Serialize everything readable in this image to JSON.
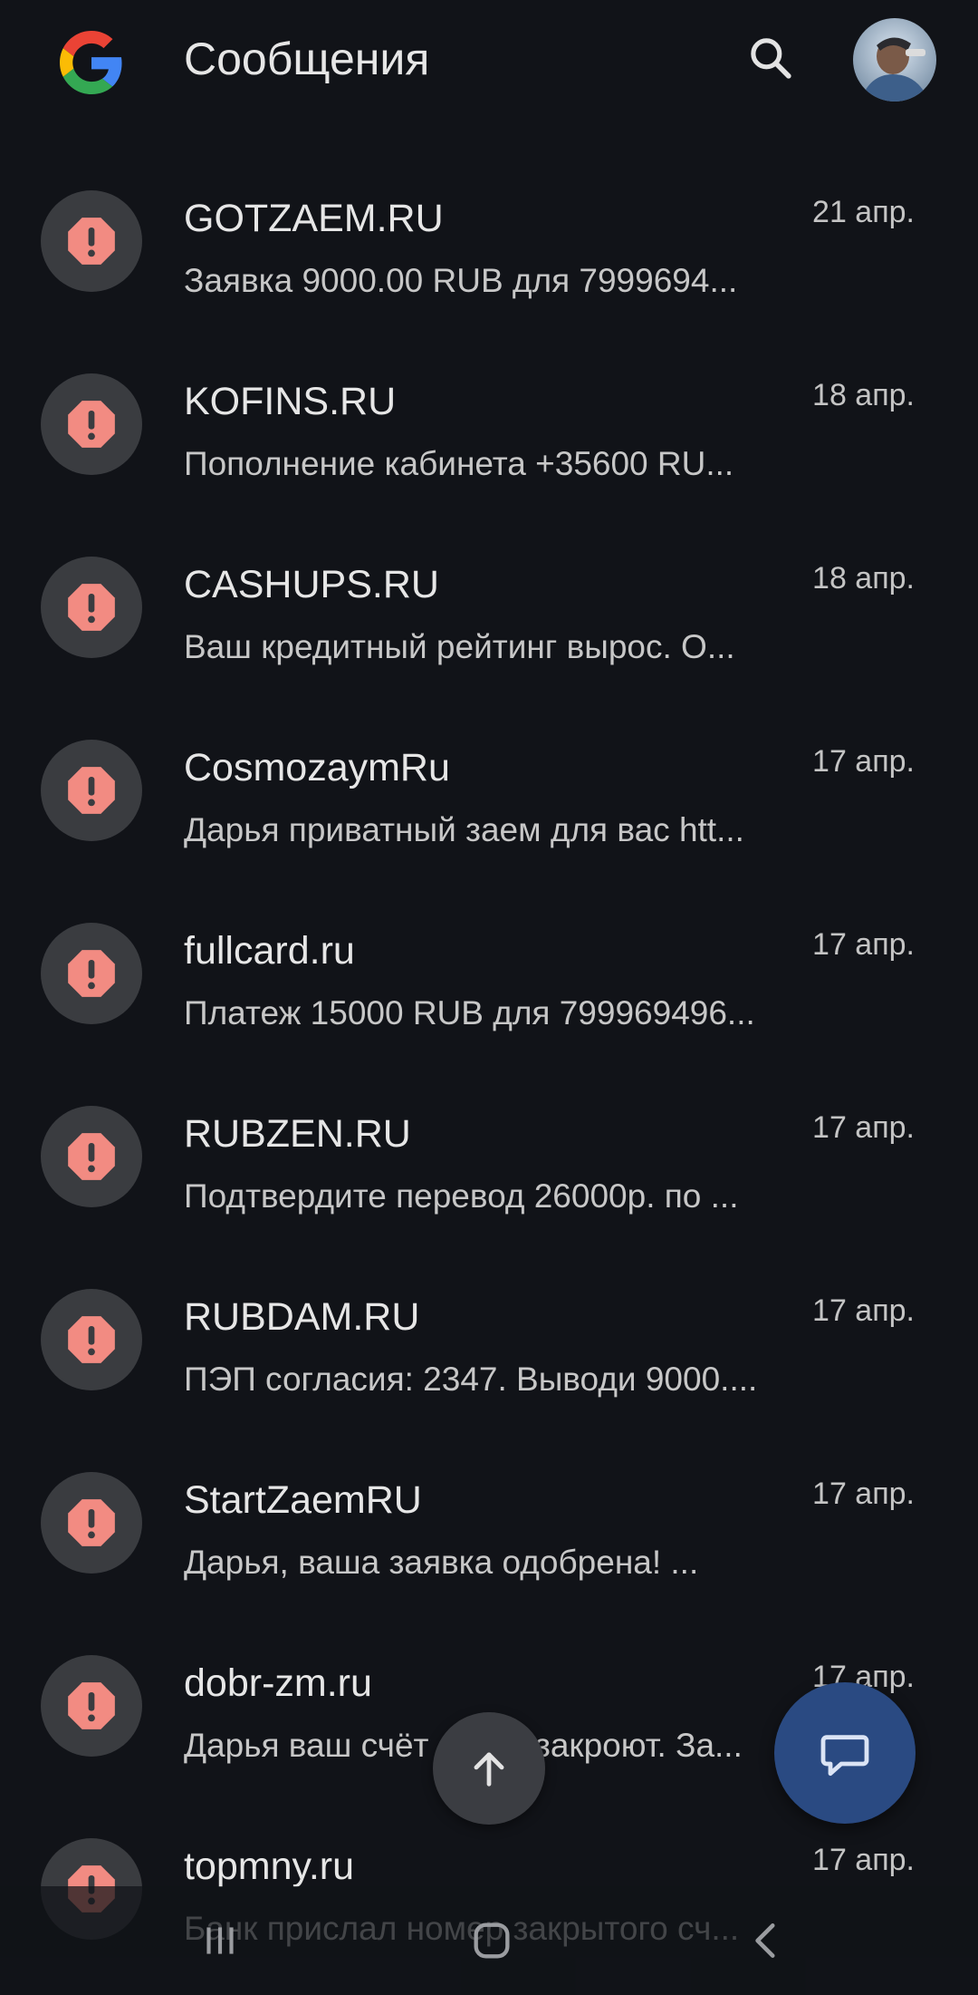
{
  "header": {
    "title": "Сообщения",
    "logo_icon": "google-g-logo",
    "search_icon": "search-icon",
    "avatar": "user-avatar"
  },
  "colors": {
    "background": "#111318",
    "alert_icon": "#f28b82",
    "alert_bg": "#3a3c40",
    "fab": "#2a4a82"
  },
  "conversations": [
    {
      "sender": "GOTZAEM.RU",
      "preview": "Заявка 9000.00 RUB для 7999694...",
      "date": "21 апр."
    },
    {
      "sender": "KOFINS.RU",
      "preview": "Пополнение кабинета +35600 RU...",
      "date": "18 апр."
    },
    {
      "sender": "CASHUPS.RU",
      "preview": "Ваш кредитный рейтинг вырос. О...",
      "date": "18 апр."
    },
    {
      "sender": "CosmozaymRu",
      "preview": "Дарья приватный заем для вас htt...",
      "date": "17 апр."
    },
    {
      "sender": "fullcard.ru",
      "preview": "Платеж 15000 RUB для 799969496...",
      "date": "17 апр."
    },
    {
      "sender": "RUBZEN.RU",
      "preview": "Подтвердите перевод 26000р. по ...",
      "date": "17 апр."
    },
    {
      "sender": "RUBDAM.RU",
      "preview": "ПЭП согласия: 2347. Выводи 9000....",
      "date": "17 апр."
    },
    {
      "sender": "StartZaemRU",
      "preview": "Дарья, ваша заявка одобрена! ...",
      "date": "17 апр."
    },
    {
      "sender": "dobr-zm.ru",
      "preview": "Дарья ваш счёт скоро закроют. За...",
      "date": "17 апр."
    },
    {
      "sender": "topmny.ru",
      "preview": "Банк прислал номер закрытого сч...",
      "date": "17 апр."
    }
  ],
  "floating": {
    "scroll_top_icon": "arrow-up-icon",
    "start_chat_icon": "chat-bubble-icon"
  },
  "system_nav": {
    "recents_icon": "recents-icon",
    "home_icon": "home-icon",
    "back_icon": "back-icon"
  }
}
